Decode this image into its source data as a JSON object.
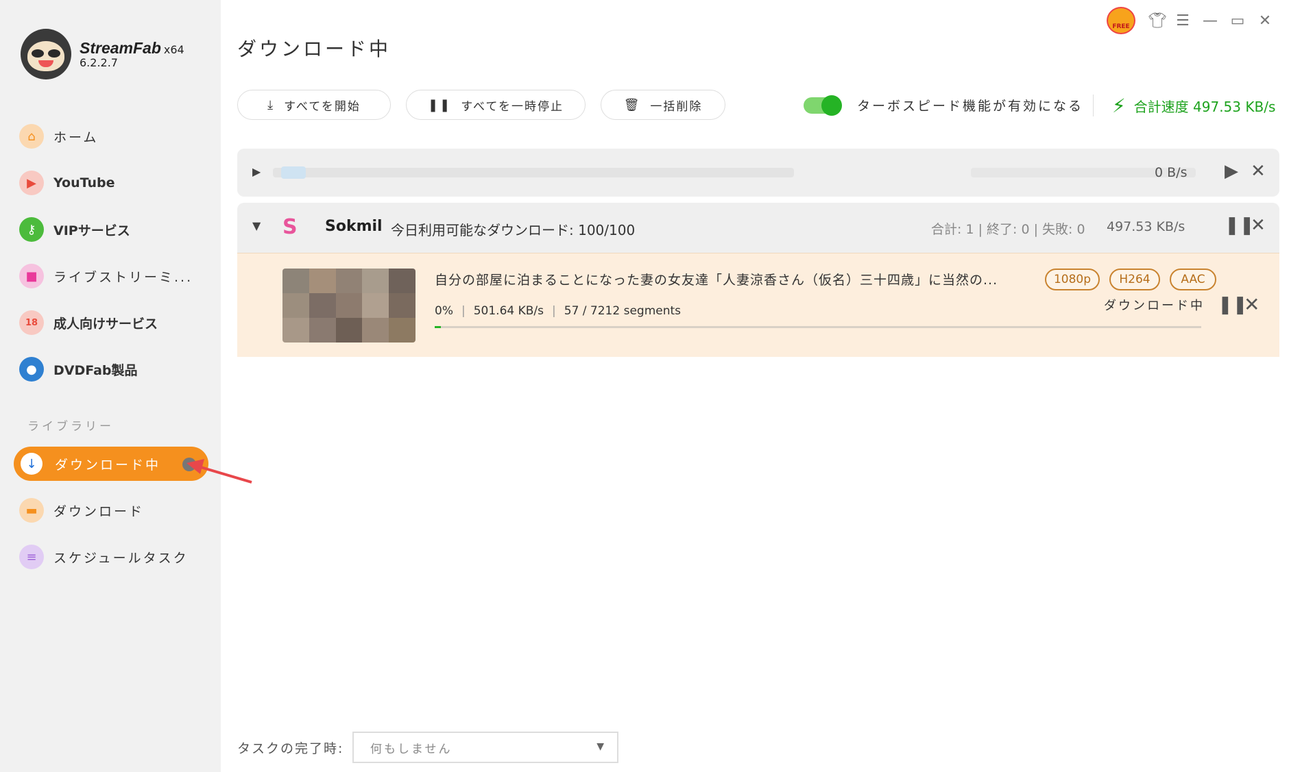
{
  "app": {
    "name": "StreamFab",
    "arch": "x64",
    "version": "6.2.2.7",
    "free_label": "FREE"
  },
  "sidebar": {
    "items": [
      {
        "label": "ホーム",
        "icon": "home-icon",
        "color": "#f5901e"
      },
      {
        "label": "YouTube",
        "icon": "youtube-icon",
        "color": "#e94b3c"
      },
      {
        "label": "VIPサービス",
        "icon": "key-icon",
        "color": "#4cbb3c"
      },
      {
        "label": "ライブストリーミ...",
        "icon": "video-camera-icon",
        "color": "#e9399a"
      },
      {
        "label": "成人向けサービス",
        "icon": "adult-18-icon",
        "color": "#e94b3c"
      },
      {
        "label": "DVDFab製品",
        "icon": "dvdfab-icon",
        "color": "#2f80d1"
      }
    ],
    "library_label": "ライブラリー",
    "library_items": [
      {
        "label": "ダウンロード中",
        "icon": "download-icon",
        "active": true
      },
      {
        "label": "ダウンロード",
        "icon": "folder-icon",
        "color": "#f5901e"
      },
      {
        "label": "スケジュールタスク",
        "icon": "schedule-icon",
        "color": "#a064d8"
      }
    ]
  },
  "main": {
    "title": "ダウンロード中",
    "toolbar": {
      "start_all": "すべてを開始",
      "pause_all": "すべてを一時停止",
      "delete_all": "一括削除"
    },
    "turbo": {
      "label": "ターボスピード機能が有効になる",
      "enabled": true
    },
    "total_speed_label": "合計速度 497.53 KB/s",
    "accent_green": "#1ea31e",
    "accent_orange": "#f5901e"
  },
  "groups": [
    {
      "collapsed": true,
      "speed": "0 B/s"
    },
    {
      "collapsed": false,
      "logo": "S",
      "name": "Sokmil",
      "quota": "今日利用可能なダウンロード: 100/100",
      "stats": "合計: 1 | 終了: 0 | 失敗: 0",
      "speed": "497.53 KB/s"
    }
  ],
  "task": {
    "title": "自分の部屋に泊まることになった妻の女友達「人妻涼香さん（仮名）三十四歳」に当然の...",
    "tags": [
      "1080p",
      "H264",
      "AAC"
    ],
    "percent": "0%",
    "speed": "501.64 KB/s",
    "segments": "57 / 7212 segments",
    "progress_fraction": 0.0079,
    "status": "ダウンロード中"
  },
  "footer": {
    "label": "タスクの完了時:",
    "select_value": "何もしません"
  }
}
